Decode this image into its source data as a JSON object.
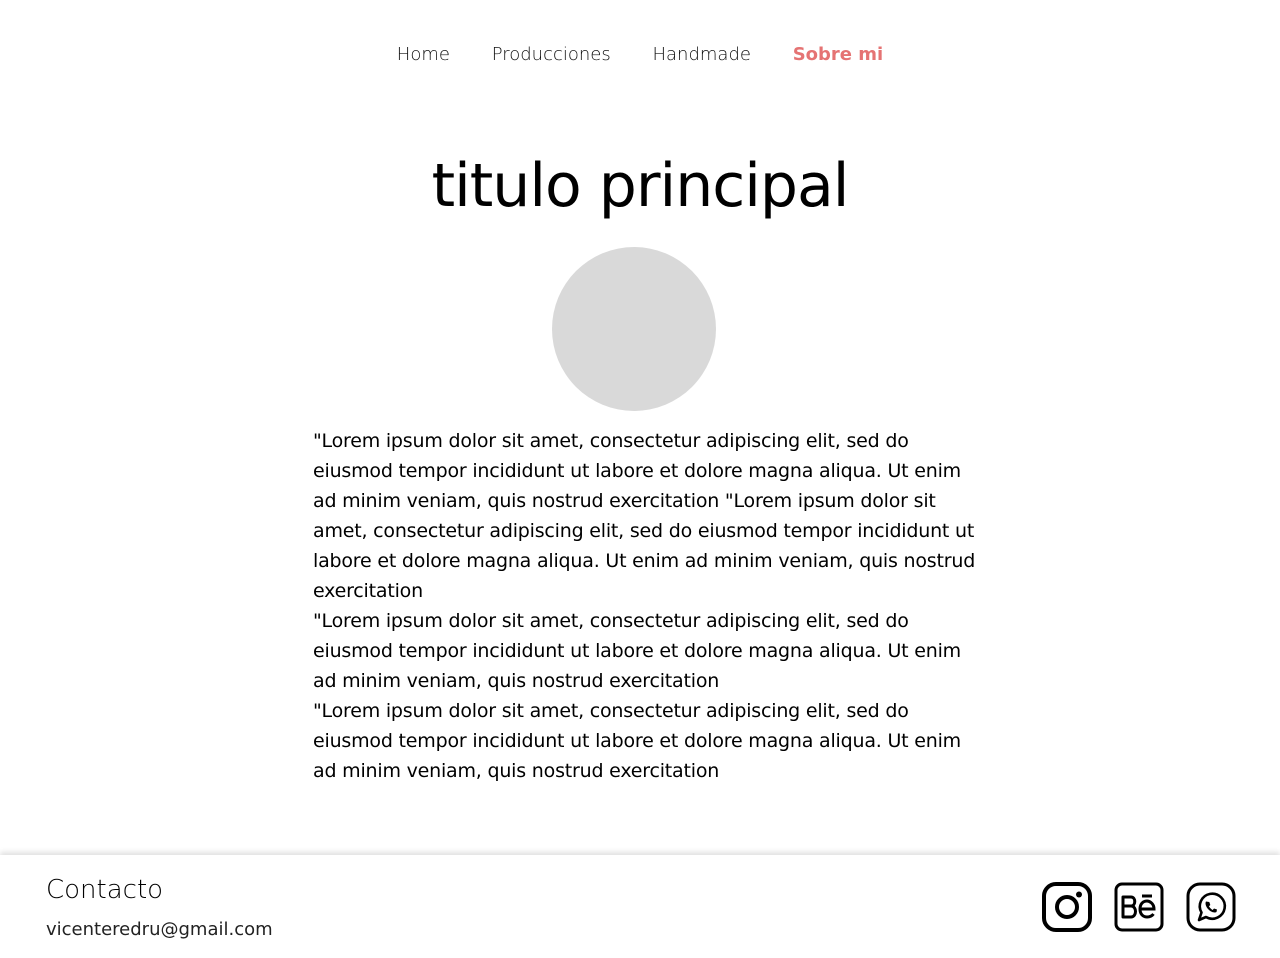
{
  "nav": {
    "items": [
      {
        "label": "Home",
        "active": false
      },
      {
        "label": "Producciones",
        "active": false
      },
      {
        "label": "Handmade",
        "active": false
      },
      {
        "label": "Sobre mi",
        "active": true
      }
    ]
  },
  "main": {
    "title": "titulo principal",
    "paragraphs": [
      "\"Lorem ipsum dolor sit amet, consectetur adipiscing elit, sed do eiusmod tempor incididunt ut labore et dolore magna aliqua. Ut enim ad minim veniam, quis nostrud exercitation \"Lorem ipsum dolor sit amet, consectetur adipiscing elit, sed do eiusmod tempor incididunt ut labore et dolore magna aliqua. Ut enim ad minim veniam, quis nostrud exercitation",
      "\"Lorem ipsum dolor sit amet, consectetur adipiscing elit, sed do eiusmod tempor incididunt ut labore et dolore magna aliqua. Ut enim ad minim veniam, quis nostrud exercitation",
      "\"Lorem ipsum dolor sit amet, consectetur adipiscing elit, sed do eiusmod tempor incididunt ut labore et dolore magna aliqua. Ut enim ad minim veniam, quis nostrud exercitation"
    ]
  },
  "footer": {
    "title": "Contacto",
    "email": "vicenteredru@gmail.com",
    "socials": [
      "instagram-icon",
      "behance-icon",
      "whatsapp-icon"
    ]
  },
  "colors": {
    "accent": "#e57373",
    "avatar_placeholder": "#d9d9d9"
  }
}
